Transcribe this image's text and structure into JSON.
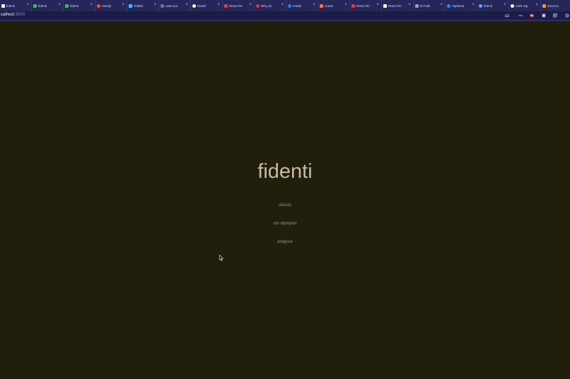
{
  "browser": {
    "tabs": [
      {
        "label": "fidenti",
        "color": "#ffffff",
        "icon": "page-icon"
      },
      {
        "label": "fidenti",
        "color": "#4caf50",
        "icon": "page-icon"
      },
      {
        "label": "fidenti",
        "color": "#4caf50",
        "icon": "page-icon"
      },
      {
        "label": "reactjs",
        "color": "#ff5700",
        "icon": "reddit-icon"
      },
      {
        "label": "Tailwin",
        "color": "#38bdf8",
        "icon": "tailwind-icon"
      },
      {
        "label": "useLoca",
        "color": "#6b7280",
        "icon": "page-icon"
      },
      {
        "label": "Israeli",
        "color": "#ffffff",
        "icon": "github-icon"
      },
      {
        "label": "React Ro",
        "color": "#e53935",
        "icon": "youtube-icon"
      },
      {
        "label": "Why do",
        "color": "#e53935",
        "icon": "page-icon"
      },
      {
        "label": "Inside",
        "color": "#1e88e5",
        "icon": "page-icon"
      },
      {
        "label": "nctum",
        "color": "#ff7043",
        "icon": "page-icon"
      },
      {
        "label": "React Ro",
        "color": "#e53935",
        "icon": "youtube-icon"
      },
      {
        "label": "React Ro",
        "color": "#ffffff",
        "icon": "page-icon"
      },
      {
        "label": "B Publi",
        "color": "#9ca3af",
        "icon": "page-icon"
      },
      {
        "label": "AlphaHa",
        "color": "#3b82f6",
        "icon": "page-icon"
      },
      {
        "label": "fidenti",
        "color": "#60a5fa",
        "icon": "page-icon"
      },
      {
        "label": "ASR-Alp",
        "color": "#ffffff",
        "icon": "github-icon"
      },
      {
        "label": "amazon",
        "color": "#ff9800",
        "icon": "amazon-icon"
      }
    ],
    "url_host": "calhost",
    "url_port": ":3000",
    "tab_close": "×",
    "toolbar_icons": [
      "cloud-icon",
      "minus-icon",
      "extension-icon",
      "translate-icon",
      "qr-icon",
      "settings-icon"
    ]
  },
  "page": {
    "title": "fidenti",
    "links": [
      {
        "label": "classic"
      },
      {
        "label": "um olympics"
      },
      {
        "label": "analysis"
      }
    ]
  },
  "colors": {
    "background": "#1f1f0b",
    "title": "#c9b9a4",
    "link": "#9d9483",
    "tabbar": "#25265a"
  }
}
